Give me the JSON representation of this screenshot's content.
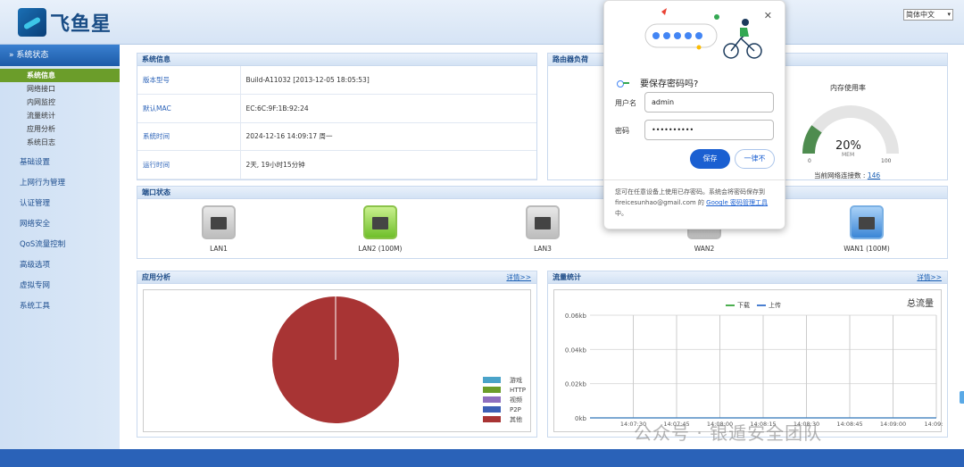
{
  "header": {
    "logo_text": "飞鱼星",
    "language": "简体中文"
  },
  "sidebar": {
    "group_title": "系统状态",
    "sub_items": [
      "系统信息",
      "网络接口",
      "内网监控",
      "流量统计",
      "应用分析",
      "系统日志"
    ],
    "items": [
      "基础设置",
      "上网行为管理",
      "认证管理",
      "网络安全",
      "QoS流量控制",
      "高级选项",
      "虚拟专网",
      "系统工具"
    ]
  },
  "system_info": {
    "title": "系统信息",
    "rows": [
      {
        "key": "版本型号",
        "value": "Build-A11032 [2013-12-05 18:05:53]"
      },
      {
        "key": "默认MAC",
        "value": "EC:6C:9F:1B:92:24"
      },
      {
        "key": "系统时间",
        "value": "2024-12-16 14:09:17 周一"
      },
      {
        "key": "运行时间",
        "value": "2天, 19小时15分钟"
      }
    ]
  },
  "router_load": {
    "title": "路由器负荷",
    "memory_title": "内存使用率",
    "memory_percent": "20%",
    "memory_unit": "MEM",
    "memory_value": 20,
    "scale_min": "0",
    "scale_max": "100",
    "connections_label": "当前网络连接数 :",
    "connections_value": "146"
  },
  "ports": {
    "title": "端口状态",
    "items": [
      {
        "label": "LAN1",
        "state": "grey"
      },
      {
        "label": "LAN2 (100M)",
        "state": "green"
      },
      {
        "label": "LAN3",
        "state": "grey"
      },
      {
        "label": "WAN2",
        "state": "grey"
      },
      {
        "label": "WAN1 (100M)",
        "state": "blue"
      }
    ]
  },
  "app_analysis": {
    "title": "应用分析",
    "more": "详情>>",
    "legend": [
      {
        "name": "游戏",
        "color": "#4aa3c9"
      },
      {
        "name": "HTTP",
        "color": "#6b9d2a"
      },
      {
        "name": "视频",
        "color": "#8e6fbf"
      },
      {
        "name": "P2P",
        "color": "#3c5fb5"
      },
      {
        "name": "其他",
        "color": "#a83434"
      }
    ]
  },
  "traffic": {
    "title": "流量统计",
    "more": "详情>>",
    "chart_title": "总流量",
    "legend_down": "下载",
    "legend_up": "上传",
    "y_ticks": [
      "0.06kb",
      "0.04kb",
      "0.02kb",
      "0kb"
    ],
    "x_ticks": [
      "14:07:30",
      "14:07:45",
      "14:08:00",
      "14:08:15",
      "14:08:30",
      "14:08:45",
      "14:09:00",
      "14:09:"
    ]
  },
  "chart_data": [
    {
      "type": "pie",
      "categories": [
        "游戏",
        "HTTP",
        "视频",
        "P2P",
        "其他"
      ],
      "values": [
        0,
        0,
        0,
        0,
        100
      ]
    },
    {
      "type": "line",
      "title": "总流量",
      "x": [
        "14:07:30",
        "14:07:45",
        "14:08:00",
        "14:08:15",
        "14:08:30",
        "14:08:45",
        "14:09:00",
        "14:09:"
      ],
      "series": [
        {
          "name": "下载",
          "values": [
            0,
            0,
            0,
            0,
            0,
            0,
            0,
            0
          ]
        },
        {
          "name": "上传",
          "values": [
            0,
            0,
            0,
            0,
            0,
            0,
            0,
            0
          ]
        }
      ],
      "ylim": [
        0,
        0.06
      ]
    }
  ],
  "password_popup": {
    "title": "要保存密码吗?",
    "username_label": "用户名",
    "username_value": "admin",
    "password_label": "密码",
    "password_value": "••••••••••",
    "save_label": "保存",
    "never_label": "一律不",
    "note_prefix": "您可在任意设备上使用已存密码。系统会将密码保存到 fireicesunhao@gmail.com 的 ",
    "note_link": "Google 密码管理工具",
    "note_suffix": "中。"
  },
  "watermark": "公众号 · 银遁安全团队"
}
